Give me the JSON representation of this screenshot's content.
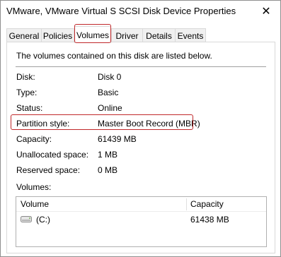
{
  "window": {
    "title": "VMware, VMware Virtual S SCSI Disk Device Properties",
    "close_glyph": "✕"
  },
  "tabs": [
    {
      "label": "General",
      "active": false
    },
    {
      "label": "Policies",
      "active": false
    },
    {
      "label": "Volumes",
      "active": true
    },
    {
      "label": "Driver",
      "active": false
    },
    {
      "label": "Details",
      "active": false
    },
    {
      "label": "Events",
      "active": false
    }
  ],
  "panel": {
    "intro": "The volumes contained on this disk are listed below.",
    "properties": [
      {
        "label": "Disk:",
        "value": "Disk 0"
      },
      {
        "label": "Type:",
        "value": "Basic"
      },
      {
        "label": "Status:",
        "value": "Online"
      },
      {
        "label": "Partition style:",
        "value": "Master Boot Record (MBR)"
      },
      {
        "label": "Capacity:",
        "value": "61439 MB"
      },
      {
        "label": "Unallocated space:",
        "value": "1 MB"
      },
      {
        "label": "Reserved space:",
        "value": "0 MB"
      }
    ],
    "volumes_label": "Volumes:",
    "volumes_table": {
      "columns": [
        "Volume",
        "Capacity"
      ],
      "rows": [
        {
          "icon": "drive-icon",
          "volume": "(C:)",
          "capacity": "61438 MB"
        }
      ]
    }
  },
  "colors": {
    "highlight_outline": "#c0282a",
    "tab_border": "#d9d9d9"
  }
}
